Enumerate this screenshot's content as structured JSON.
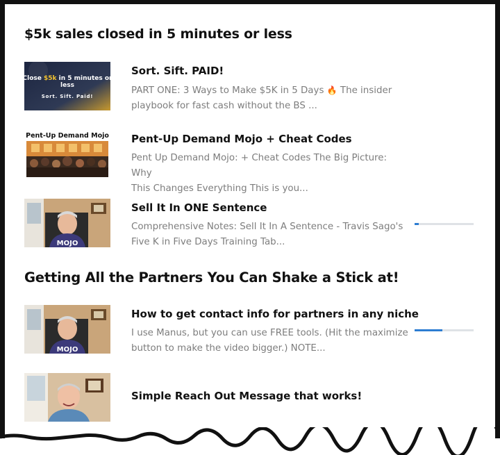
{
  "sections": [
    {
      "title": "$5k sales closed in 5 minutes or less",
      "lessons": [
        {
          "title": "Sort. Sift. PAID!",
          "desc_line1": "  PART ONE: 3 Ways to Make $5K in 5 Days",
          "desc_line1_after": " The insider",
          "desc_line2": "playbook for fast cash without the BS ...",
          "thumb": {
            "line1a": "Close ",
            "line1b": "$5k",
            "line1c": " in 5 minutes or",
            "line2": "less",
            "line3": "Sort. Sift. Paid!",
            "accent": "#f2c230"
          }
        },
        {
          "title": "Pent-Up Demand Mojo + Cheat Codes",
          "desc_line1": "  Pent Up Demand Mojo: + Cheat Codes The Big Picture: Why",
          "desc_line2": "This Changes Everything This is you...",
          "thumb": {
            "caption": "Pent-Up Demand Mojo"
          }
        },
        {
          "title": "Sell It In ONE Sentence",
          "desc_line1": "  Comprehensive Notes: Sell It In A Sentence - Travis Sago's",
          "desc_line2": "Five K in Five Days Training Tab...",
          "progress": 0.07,
          "thumb": {
            "shirt_text": "MOJO"
          }
        }
      ]
    },
    {
      "title": "Getting All the Partners You Can Shake a Stick at!",
      "lessons": [
        {
          "title": "How to get contact info for partners in any niche",
          "desc_line1": "I use Manus, but you can use FREE tools. (Hit the maximize",
          "desc_line2": "button to make the video bigger.) NOTE...",
          "progress": 0.47,
          "thumb": {
            "shirt_text": "MOJO"
          }
        },
        {
          "title": "Simple Reach Out Message that works!",
          "thumb": {}
        }
      ]
    }
  ],
  "colors": {
    "progress_fill": "#2d7dd2",
    "progress_track": "#dfe2e6",
    "text_dark": "#111111",
    "text_muted": "#7d7d7d"
  },
  "icons": {
    "flame": "fire-icon"
  }
}
